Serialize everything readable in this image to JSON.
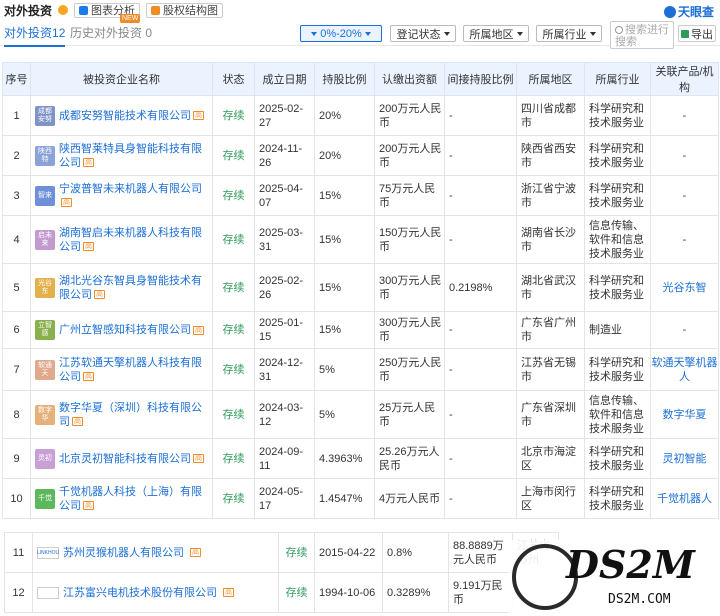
{
  "header": {
    "title": "对外投资",
    "chart_btn": "图表分析",
    "equity_btn": "股权结构图",
    "brand": "天眼查"
  },
  "tabs": {
    "current_label": "对外投资",
    "current_count": "12",
    "history_label": "历史对外投资",
    "history_count": "0",
    "new_badge": "NEW"
  },
  "filters": {
    "ratio": "0%-20%",
    "reg_status": "登记状态",
    "region": "所属地区",
    "industry": "所属行业",
    "search_placeholder": "搜索进行搜索",
    "export": "导出"
  },
  "columns": [
    "序号",
    "被投资企业名称",
    "状态",
    "成立日期",
    "持股比例",
    "认缴出资额",
    "间接持股比例",
    "所属地区",
    "所属行业",
    "关联产品/机构"
  ],
  "rows": [
    {
      "idx": "1",
      "logo": "成都安努",
      "logo_color": "#7f93c8",
      "name": "成都安努智能技术有限公司",
      "status": "存续",
      "date": "2025-02-27",
      "ratio": "20%",
      "capital": "200万元人民币",
      "indirect": "-",
      "region": "四川省成都市",
      "industry": "科学研究和技术服务业",
      "product": "-"
    },
    {
      "idx": "2",
      "logo": "陕西特",
      "logo_color": "#8aa2d6",
      "name": "陕西智莱特具身智能科技有限公司",
      "status": "存续",
      "date": "2024-11-26",
      "ratio": "20%",
      "capital": "200万元人民币",
      "indirect": "-",
      "region": "陕西省西安市",
      "industry": "科学研究和技术服务业",
      "product": "-"
    },
    {
      "idx": "3",
      "logo": "智来",
      "logo_color": "#6f90d8",
      "name": "宁波普智未来机器人有限公司",
      "status": "存续",
      "date": "2025-04-07",
      "ratio": "15%",
      "capital": "75万元人民币",
      "indirect": "-",
      "region": "浙江省宁波市",
      "industry": "科学研究和技术服务业",
      "product": "-"
    },
    {
      "idx": "4",
      "logo": "启未来",
      "logo_color": "#c29ad0",
      "name": "湖南智启未来机器人科技有限公司",
      "status": "存续",
      "date": "2025-03-31",
      "ratio": "15%",
      "capital": "150万元人民币",
      "indirect": "-",
      "region": "湖南省长沙市",
      "industry": "信息传输、软件和信息技术服务业",
      "product": "-"
    },
    {
      "idx": "5",
      "logo": "光谷东",
      "logo_color": "#e3b04b",
      "name": "湖北光谷东智具身智能技术有限公司",
      "status": "存续",
      "date": "2025-02-26",
      "ratio": "15%",
      "capital": "300万元人民币",
      "indirect": "0.2198%",
      "region": "湖北省武汉市",
      "industry": "科学研究和技术服务业",
      "product": "光谷东智"
    },
    {
      "idx": "6",
      "logo": "立智感",
      "logo_color": "#8ab04e",
      "name": "广州立智感知科技有限公司",
      "status": "存续",
      "date": "2025-01-15",
      "ratio": "15%",
      "capital": "300万元人民币",
      "indirect": "-",
      "region": "广东省广州市",
      "industry": "制造业",
      "product": "-"
    },
    {
      "idx": "7",
      "logo": "软通天",
      "logo_color": "#e0a88c",
      "name": "江苏软通天擎机器人科技有限公司",
      "status": "存续",
      "date": "2024-12-31",
      "ratio": "5%",
      "capital": "250万元人民币",
      "indirect": "-",
      "region": "江苏省无锡市",
      "industry": "科学研究和技术服务业",
      "product": "软通天擎机器人"
    },
    {
      "idx": "8",
      "logo": "数字华",
      "logo_color": "#e6b07a",
      "name": "数字华夏（深圳）科技有限公司",
      "status": "存续",
      "date": "2024-03-12",
      "ratio": "5%",
      "capital": "25万元人民币",
      "indirect": "-",
      "region": "广东省深圳市",
      "industry": "信息传输、软件和信息技术服务业",
      "product": "数字华夏"
    },
    {
      "idx": "9",
      "logo": "灵初",
      "logo_color": "#c9a0d6",
      "name": "北京灵初智能科技有限公司",
      "status": "存续",
      "date": "2024-09-11",
      "ratio": "4.3963%",
      "capital": "25.26万元人民币",
      "indirect": "-",
      "region": "北京市海淀区",
      "industry": "科学研究和技术服务业",
      "product": "灵初智能"
    },
    {
      "idx": "10",
      "logo": "千觉",
      "logo_color": "#5cb85c",
      "name": "千觉机器人科技（上海）有限公司",
      "status": "存续",
      "date": "2024-05-17",
      "ratio": "1.4547%",
      "capital": "4万元人民币",
      "indirect": "-",
      "region": "上海市闵行区",
      "industry": "科学研究和技术服务业",
      "product": "千觉机器人"
    }
  ],
  "sub_rows": [
    {
      "idx": "11",
      "logo": "LINKHOU",
      "name": "苏州灵猴机器人有限公司",
      "status": "存续",
      "date": "2015-04-22",
      "ratio": "0.8%",
      "capital": "88.8889万元人民币",
      "region": "江苏省苏州"
    },
    {
      "idx": "12",
      "logo": "",
      "name": "江苏富兴电机技术股份有限公司",
      "status": "存续",
      "date": "1994-10-06",
      "ratio": "0.3289%",
      "capital": "9.191万民币",
      "region": ""
    }
  ],
  "watermark": {
    "big": "DS2M",
    "small": "DS2M.COM"
  }
}
